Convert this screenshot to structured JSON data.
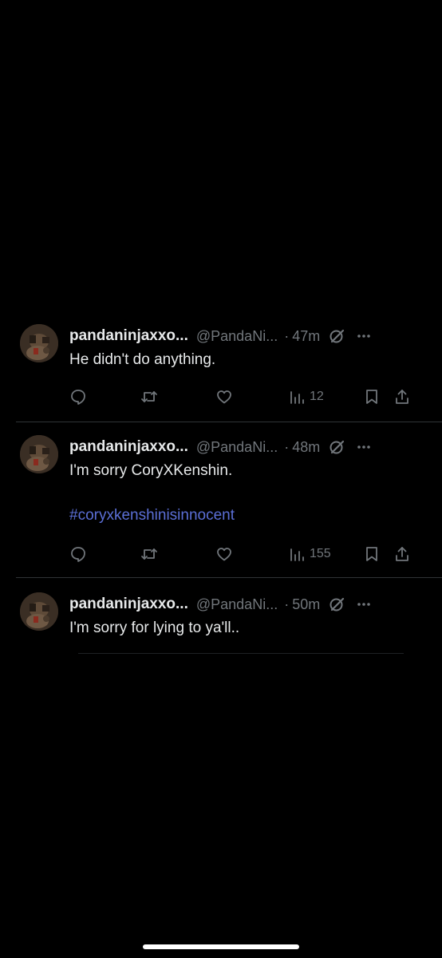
{
  "tweets": [
    {
      "display_name": "pandaninjaxxo...",
      "handle": "@PandaNi...",
      "separator": "·",
      "time": "47m",
      "text": "He didn't do anything.",
      "hashtag": null,
      "views": "12"
    },
    {
      "display_name": "pandaninjaxxo...",
      "handle": "@PandaNi...",
      "separator": "·",
      "time": "48m",
      "text": "I'm sorry CoryXKenshin.",
      "hashtag": "#coryxkenshinisinnocent",
      "views": "155"
    },
    {
      "display_name": "pandaninjaxxo...",
      "handle": "@PandaNi...",
      "separator": "·",
      "time": "50m",
      "text": "I'm sorry for lying to ya'll..",
      "hashtag": null,
      "views": null
    }
  ],
  "icons": {
    "reply": "reply-icon",
    "retweet": "retweet-icon",
    "like": "heart-icon",
    "views": "views-icon",
    "bookmark": "bookmark-icon",
    "share": "share-icon",
    "grok": "grok-icon",
    "more": "more-icon"
  },
  "colors": {
    "background": "#000000",
    "text": "#e7e9ea",
    "muted": "#71767b",
    "hashtag": "#5b6fd6",
    "divider": "#2f3336"
  }
}
